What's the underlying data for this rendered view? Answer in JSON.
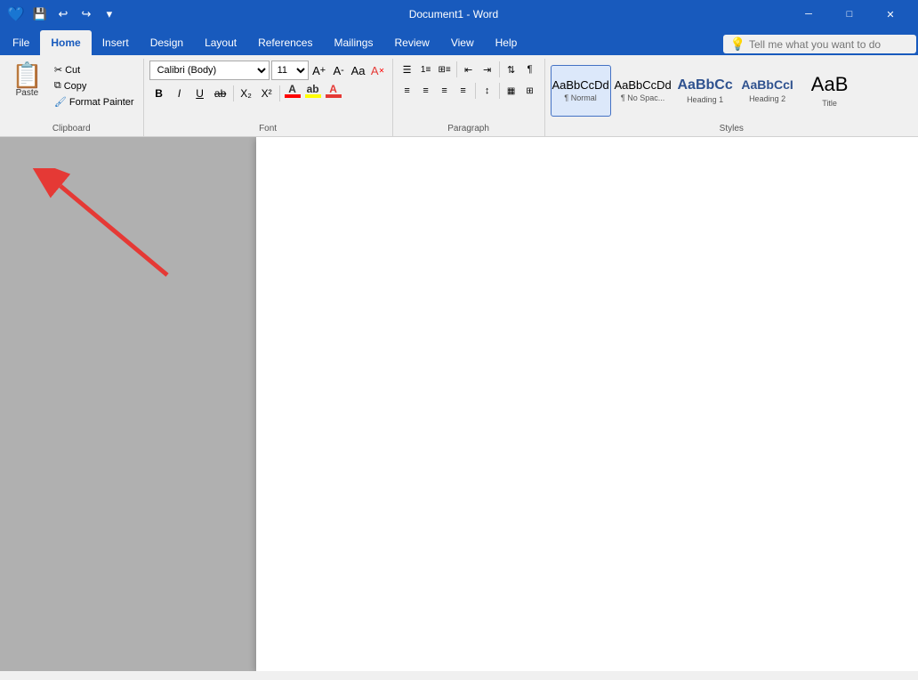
{
  "titlebar": {
    "title": "Document1 - Word",
    "save_icon": "💾",
    "undo_icon": "↩",
    "redo_icon": "↪",
    "dropdown_icon": "▾",
    "minimize": "─",
    "restore": "□",
    "close": "✕"
  },
  "tabs": [
    {
      "id": "file",
      "label": "File"
    },
    {
      "id": "home",
      "label": "Home",
      "active": true
    },
    {
      "id": "insert",
      "label": "Insert"
    },
    {
      "id": "design",
      "label": "Design"
    },
    {
      "id": "layout",
      "label": "Layout"
    },
    {
      "id": "references",
      "label": "References"
    },
    {
      "id": "mailings",
      "label": "Mailings"
    },
    {
      "id": "review",
      "label": "Review"
    },
    {
      "id": "view",
      "label": "View"
    },
    {
      "id": "help",
      "label": "Help"
    }
  ],
  "search": {
    "placeholder": "Tell me what you want to do"
  },
  "ribbon": {
    "clipboard": {
      "paste_label": "Paste",
      "cut_label": "Cut",
      "copy_label": "Copy",
      "format_painter_label": "Format Painter",
      "group_label": "Clipboard"
    },
    "font": {
      "font_name": "Calibri (Body)",
      "font_size": "11",
      "group_label": "Font",
      "bold": "B",
      "italic": "I",
      "underline": "U",
      "strikethrough": "ab",
      "subscript": "X₂",
      "superscript": "X²"
    },
    "paragraph": {
      "group_label": "Paragraph"
    },
    "styles": {
      "group_label": "Styles",
      "items": [
        {
          "id": "normal",
          "preview": "AaBbCcDd",
          "name": "¶ Normal",
          "active": true
        },
        {
          "id": "nospace",
          "preview": "AaBbCcDd",
          "name": "¶ No Spac..."
        },
        {
          "id": "h1",
          "preview": "AaBbCc",
          "name": "Heading 1"
        },
        {
          "id": "h2",
          "preview": "AaBbCcI",
          "name": "Heading 2"
        },
        {
          "id": "title",
          "preview": "AaB",
          "name": "Title"
        }
      ]
    }
  }
}
